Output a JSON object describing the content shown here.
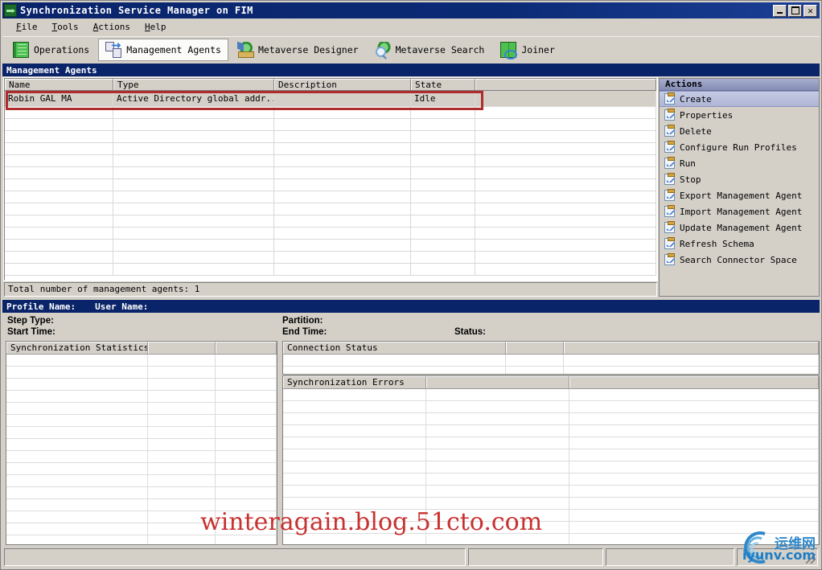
{
  "window": {
    "title": "Synchronization Service Manager on FIM",
    "icon": "sync-arrows-icon",
    "controls": [
      {
        "name": "minimize-button",
        "label": "_"
      },
      {
        "name": "maximize-button",
        "label": "□"
      },
      {
        "name": "close-button",
        "label": "✕"
      }
    ]
  },
  "menu": [
    {
      "accel": "F",
      "rest": "ile"
    },
    {
      "accel": "T",
      "rest": "ools"
    },
    {
      "accel": "A",
      "rest": "ctions"
    },
    {
      "accel": "H",
      "rest": "elp"
    }
  ],
  "toolbar": {
    "tabs": [
      {
        "label": "Operations",
        "icon": "book-icon",
        "selected": false
      },
      {
        "label": "Management Agents",
        "icon": "management-agents-icon",
        "selected": true
      },
      {
        "label": "Metaverse Designer",
        "icon": "metaverse-designer-icon",
        "selected": false
      },
      {
        "label": "Metaverse Search",
        "icon": "metaverse-search-icon",
        "selected": false
      },
      {
        "label": "Joiner",
        "icon": "joiner-icon",
        "selected": false
      }
    ]
  },
  "section_header": "Management Agents",
  "agents_table": {
    "columns": [
      "Name",
      "Type",
      "Description",
      "State"
    ],
    "rows": [
      {
        "name": "Robin GAL MA",
        "type": "Active Directory global addr...",
        "description": "",
        "state": "Idle",
        "highlighted": true
      }
    ],
    "empty_row_count": 14,
    "total_label": "Total number of management agents: 1"
  },
  "actions_pane": {
    "header": "Actions",
    "items": [
      {
        "label": "Create",
        "selected": true
      },
      {
        "label": "Properties",
        "selected": false
      },
      {
        "label": "Delete",
        "selected": false
      },
      {
        "label": "Configure Run Profiles",
        "selected": false
      },
      {
        "label": "Run",
        "selected": false
      },
      {
        "label": "Stop",
        "selected": false
      },
      {
        "label": "Export Management Agent",
        "selected": false
      },
      {
        "label": "Import Management Agent",
        "selected": false
      },
      {
        "label": "Update Management Agent",
        "selected": false
      },
      {
        "label": "Refresh Schema",
        "selected": false
      },
      {
        "label": "Search Connector Space",
        "selected": false
      }
    ]
  },
  "profile_bar": {
    "profile_name_label": "Profile Name:",
    "profile_name_value": "",
    "user_name_label": "User Name:",
    "user_name_value": ""
  },
  "details": {
    "step_type_label": "Step Type:",
    "step_type_value": "",
    "start_time_label": "Start Time:",
    "start_time_value": "",
    "partition_label": "Partition:",
    "partition_value": "",
    "end_time_label": "End Time:",
    "end_time_value": "",
    "status_label": "Status:",
    "status_value": ""
  },
  "grids": {
    "statistics": {
      "header": "Synchronization Statistics",
      "columns": [
        "Synchronization Statistics",
        "",
        ""
      ],
      "rows": [],
      "empty_row_count": 16
    },
    "connection": {
      "header": "Connection Status",
      "columns": [
        "Connection Status",
        "",
        ""
      ],
      "rows": [],
      "empty_row_count": 2
    },
    "errors": {
      "header": "Synchronization Errors",
      "columns": [
        "Synchronization Errors",
        "",
        ""
      ],
      "rows": [],
      "empty_row_count": 13
    }
  },
  "watermark": "winteragain.blog.51cto.com",
  "logo": {
    "chinese": "运维网",
    "english": "iyunv.com"
  },
  "statusbar": {
    "cells": [
      "",
      "",
      "",
      ""
    ]
  },
  "colors": {
    "titlebar": "#0a246a",
    "face": "#d4d0c8",
    "accent_red": "#b02b2b",
    "watermark_red": "#c7312f",
    "actions_header": "#848cb4",
    "logo_blue": "#1f7cc4"
  }
}
